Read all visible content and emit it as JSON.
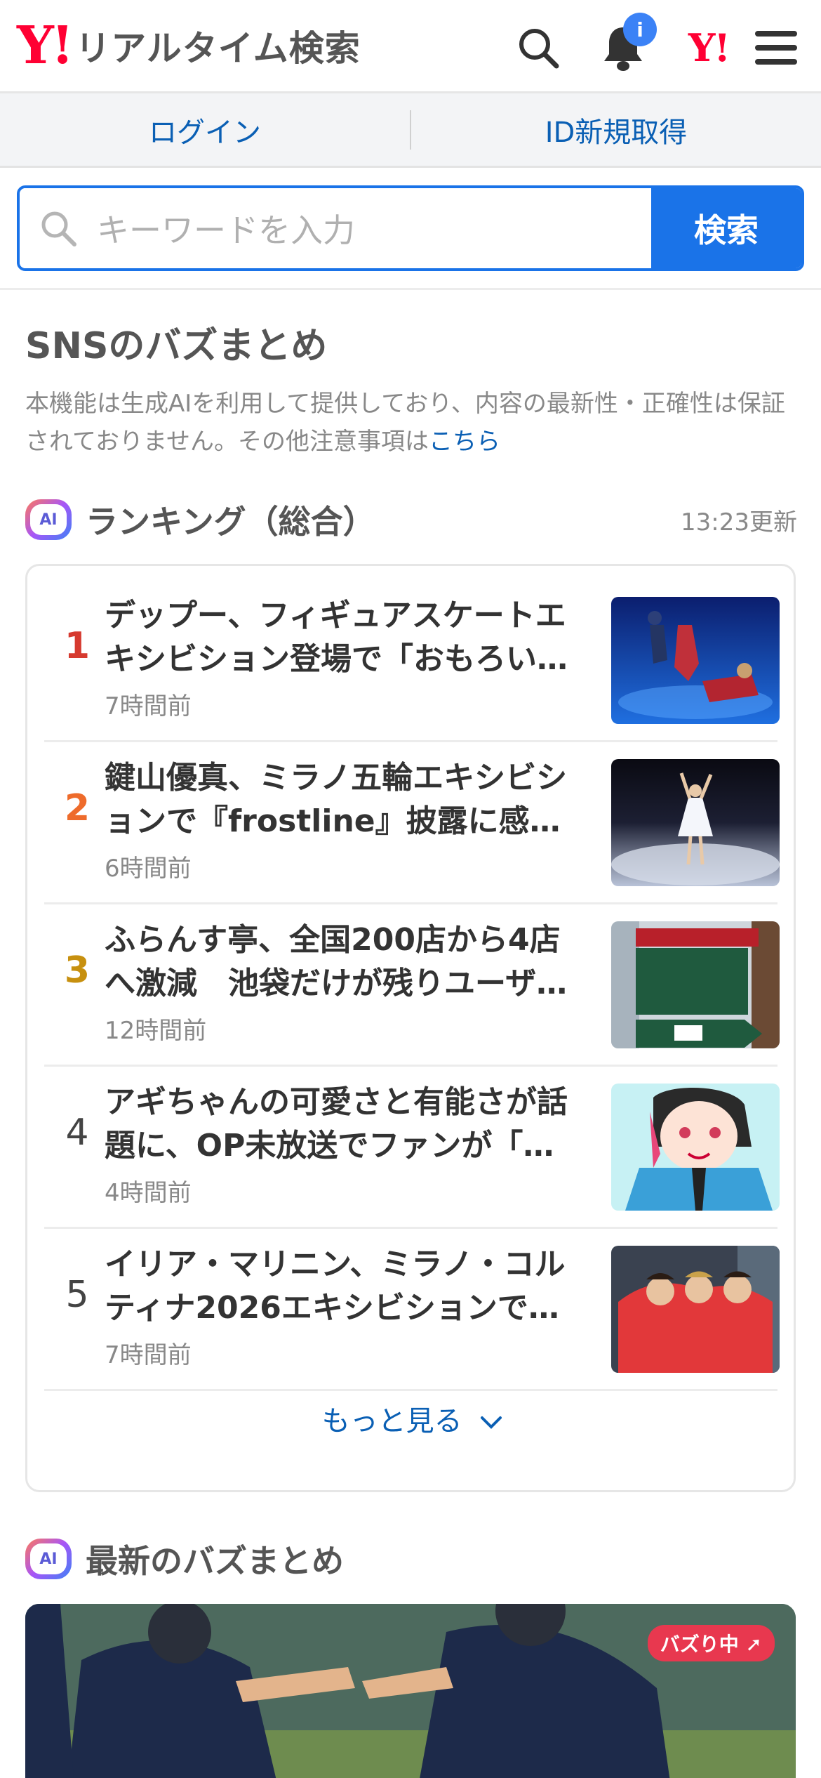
{
  "header": {
    "logo_mark": "Y!",
    "logo_text": "リアルタイム検索",
    "notification_badge": "i",
    "yahoo_mark": "Y!"
  },
  "loginbar": {
    "login": "ログイン",
    "register": "ID新規取得"
  },
  "search": {
    "placeholder": "キーワードを入力",
    "button": "検索"
  },
  "section": {
    "title": "SNSのバズまとめ",
    "disclaimer": "本機能は生成AIを利用して提供しており、内容の最新性・正確性は保証されておりません。その他注意事項は",
    "disclaimer_link": "こちら"
  },
  "ranking": {
    "ai_label": "AI",
    "title": "ランキング（総合）",
    "updated": "13:23更新",
    "more": "もっと見る",
    "items": [
      {
        "rank": "1",
        "title": "デップー、フィギュアスケートエキシビション登場で「おもろい…",
        "time": "7時間前",
        "rank_color": "#d63a2f"
      },
      {
        "rank": "2",
        "title": "鍵山優真、ミラノ五輪エキシビションで『frostline』披露に感…",
        "time": "6時間前",
        "rank_color": "#ee6b2b"
      },
      {
        "rank": "3",
        "title": "ふらんす亭、全国200店から4店へ激減　池袋だけが残りユーザ…",
        "time": "12時間前",
        "rank_color": "#c7900f"
      },
      {
        "rank": "4",
        "title": "アギちゃんの可愛さと有能さが話題に、OP未放送でファンが「…",
        "time": "4時間前",
        "rank_color": "#444444"
      },
      {
        "rank": "5",
        "title": "イリア・マリニン、ミラノ・コルティナ2026エキシビションで…",
        "time": "7時間前",
        "rank_color": "#444444"
      }
    ]
  },
  "latest": {
    "ai_label": "AI",
    "title": "最新のバズまとめ",
    "badge": "バズり中"
  }
}
